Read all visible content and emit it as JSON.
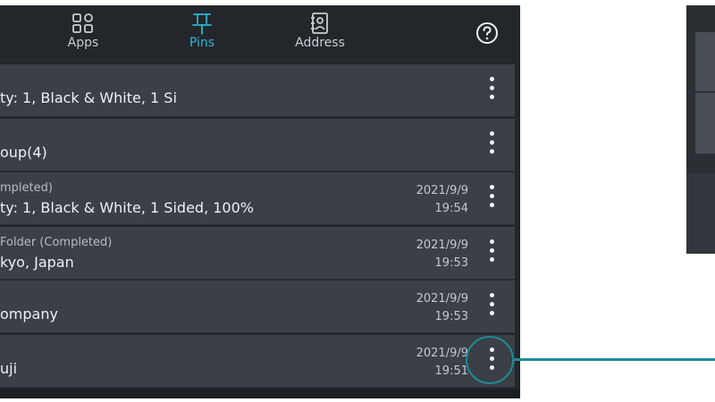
{
  "tabs": [
    {
      "label": "Apps",
      "icon": "apps-grid-icon"
    },
    {
      "label": "Pins",
      "icon": "pin-icon",
      "active": true
    },
    {
      "label": "Address",
      "icon": "address-book-icon"
    }
  ],
  "help_icon": "help-circle-icon",
  "colors": {
    "accent": "#2bb7d3",
    "callout": "#1f8a99",
    "screen_bg": "#23262b",
    "row_bg": "#3b3f46"
  },
  "rows": [
    {
      "line1": "",
      "line2": "ty: 1, Black & White, 1 Si",
      "date": "",
      "time": ""
    },
    {
      "line1": "",
      "line2": "oup(4)",
      "date": "",
      "time": ""
    },
    {
      "line1": "mpleted)",
      "line2": "ty: 1, Black & White, 1 Sided, 100%",
      "date": "2021/9/9",
      "time": "19:54"
    },
    {
      "line1": "Folder (Completed)",
      "line2": "kyo, Japan",
      "date": "2021/9/9",
      "time": "19:53"
    },
    {
      "line1": "",
      "line2": "ompany",
      "date": "2021/9/9",
      "time": "19:53"
    },
    {
      "line1": "",
      "line2": "uji",
      "date": "2021/9/9",
      "time": "19:51"
    }
  ]
}
